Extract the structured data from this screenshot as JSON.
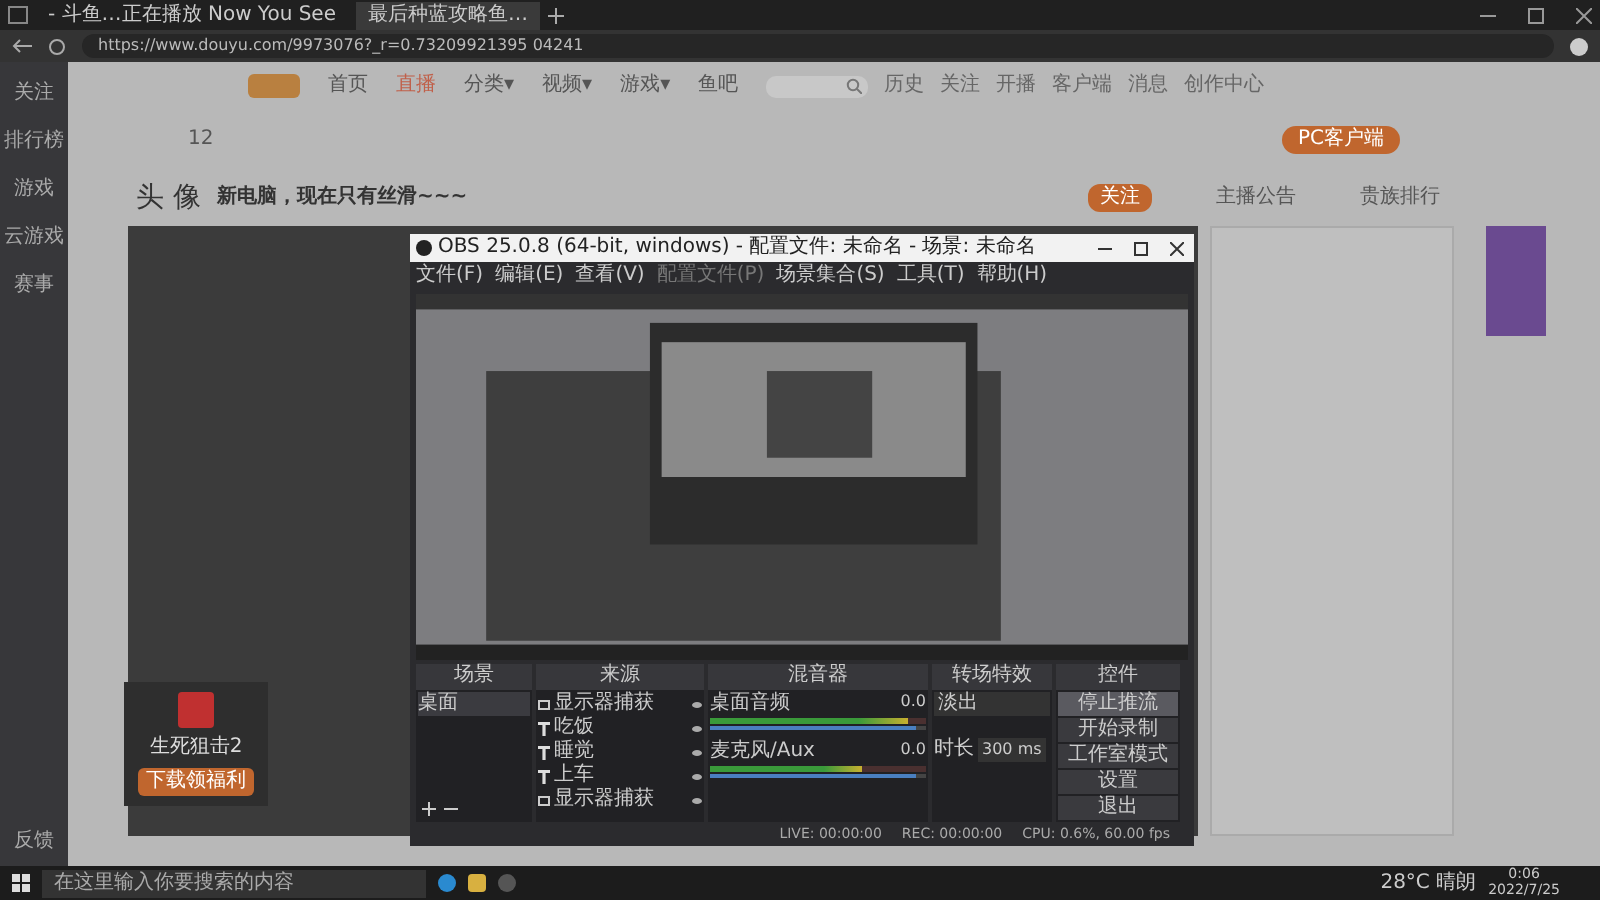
{
  "browser": {
    "tabs": [
      {
        "title": "- 斗鱼…正在播放 Now You See",
        "selected": false
      },
      {
        "title": "最后种蓝攻略鱼…",
        "selected": true
      }
    ],
    "url": "https://www.douyu.com/9973076?_r=0.73209921395 04241"
  },
  "site": {
    "nav": [
      {
        "label": "首页",
        "selected": false
      },
      {
        "label": "直播",
        "selected": true
      },
      {
        "label": "分类▾",
        "selected": false
      },
      {
        "label": "视频▾",
        "selected": false
      },
      {
        "label": "游戏▾",
        "selected": false
      },
      {
        "label": "鱼吧",
        "selected": false
      }
    ],
    "header_icons": [
      "历史",
      "关注",
      "开播",
      "客户端",
      "消息",
      "创作中心"
    ],
    "sidebar": [
      "关注",
      "排行榜",
      "游戏",
      "云游戏",
      "赛事"
    ],
    "sidebar_bottom": "反馈",
    "stream_title": "新电脑，现在只有丝滑~~~",
    "streamer": "头 像",
    "follow_count": "12",
    "follow": "关注",
    "client_button": "PC客户端",
    "right_tabs": [
      {
        "label": "主播公告",
        "selected": false
      },
      {
        "label": "贵族排行",
        "selected": false
      }
    ],
    "game_card": {
      "title": "生死狙击2",
      "button": "下载领福利"
    }
  },
  "obs": {
    "title": "OBS 25.0.8 (64-bit, windows) - 配置文件: 未命名 - 场景: 未命名",
    "menu": [
      {
        "label": "文件(F)",
        "disabled": false
      },
      {
        "label": "编辑(E)",
        "disabled": false
      },
      {
        "label": "查看(V)",
        "disabled": false
      },
      {
        "label": "配置文件(P)",
        "disabled": true
      },
      {
        "label": "场景集合(S)",
        "disabled": false
      },
      {
        "label": "工具(T)",
        "disabled": false
      },
      {
        "label": "帮助(H)",
        "disabled": false
      }
    ],
    "docks": [
      "场景",
      "来源",
      "混音器",
      "转场特效",
      "控件"
    ],
    "scenes": [
      {
        "name": "桌面",
        "selected": true
      }
    ],
    "sources": [
      {
        "name": "显示器捕获",
        "kind": "display"
      },
      {
        "name": "吃饭",
        "kind": "text"
      },
      {
        "name": "睡觉",
        "kind": "text"
      },
      {
        "name": "上车",
        "kind": "text"
      },
      {
        "name": "显示器捕获",
        "kind": "image"
      }
    ],
    "mixer": [
      {
        "name": "桌面音频",
        "reading": "0.0",
        "meter": {
          "level": 0.92
        },
        "volume": {
          "level": 0.95
        }
      },
      {
        "name": "麦克风/Aux",
        "reading": "0.0",
        "meter": {
          "level": 0.7
        },
        "volume": {
          "level": 0.95
        }
      }
    ],
    "transition": {
      "value": "淡出",
      "duration_label": "时长",
      "duration": "300 ms"
    },
    "controls": [
      {
        "label": "停止推流",
        "selected": true
      },
      {
        "label": "开始录制",
        "selected": false
      },
      {
        "label": "工作室模式",
        "selected": false
      },
      {
        "label": "设置",
        "selected": false
      },
      {
        "label": "退出",
        "selected": false
      }
    ],
    "status": [
      "LIVE: 00:00:00",
      "REC: 00:00:00",
      "CPU: 0.6%, 60.00 fps"
    ]
  },
  "taskbar": {
    "search_placeholder": "在这里输入你要搜索的内容",
    "weather": "28°C 晴朗",
    "time": "0:06",
    "date": "2022/7/25"
  }
}
